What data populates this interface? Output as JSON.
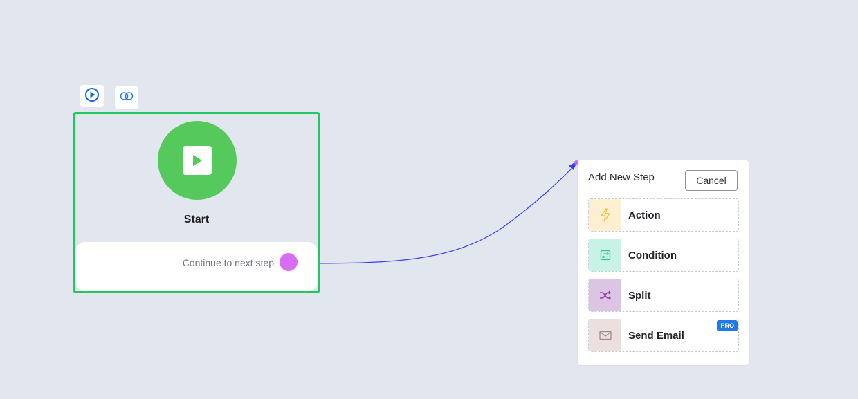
{
  "toolbar": {
    "play_icon": "play-circle-icon",
    "link_icon": "link-icon"
  },
  "start_node": {
    "title": "Start",
    "icon": "play-icon",
    "continue_label": "Continue to next step",
    "border_color": "#20c860",
    "circle_color": "#55c95b",
    "handle_color": "#d86cf2"
  },
  "connector": {
    "color": "#3d3df0"
  },
  "add_step_panel": {
    "title": "Add New Step",
    "cancel_label": "Cancel",
    "steps": [
      {
        "label": "Action",
        "icon": "lightning-icon",
        "icon_bg": "#fdf0d2",
        "icon_color": "#f3c34a"
      },
      {
        "label": "Condition",
        "icon": "condition-icon",
        "icon_bg": "#c8f2e6",
        "icon_color": "#3bbf9b"
      },
      {
        "label": "Split",
        "icon": "shuffle-icon",
        "icon_bg": "#dcc4e3",
        "icon_color": "#8f3cae"
      },
      {
        "label": "Send Email",
        "icon": "envelope-icon",
        "icon_bg": "#ece0df",
        "icon_color": "#a1898a",
        "badge": "PRO",
        "badge_color": "#1f7ae6"
      }
    ]
  }
}
